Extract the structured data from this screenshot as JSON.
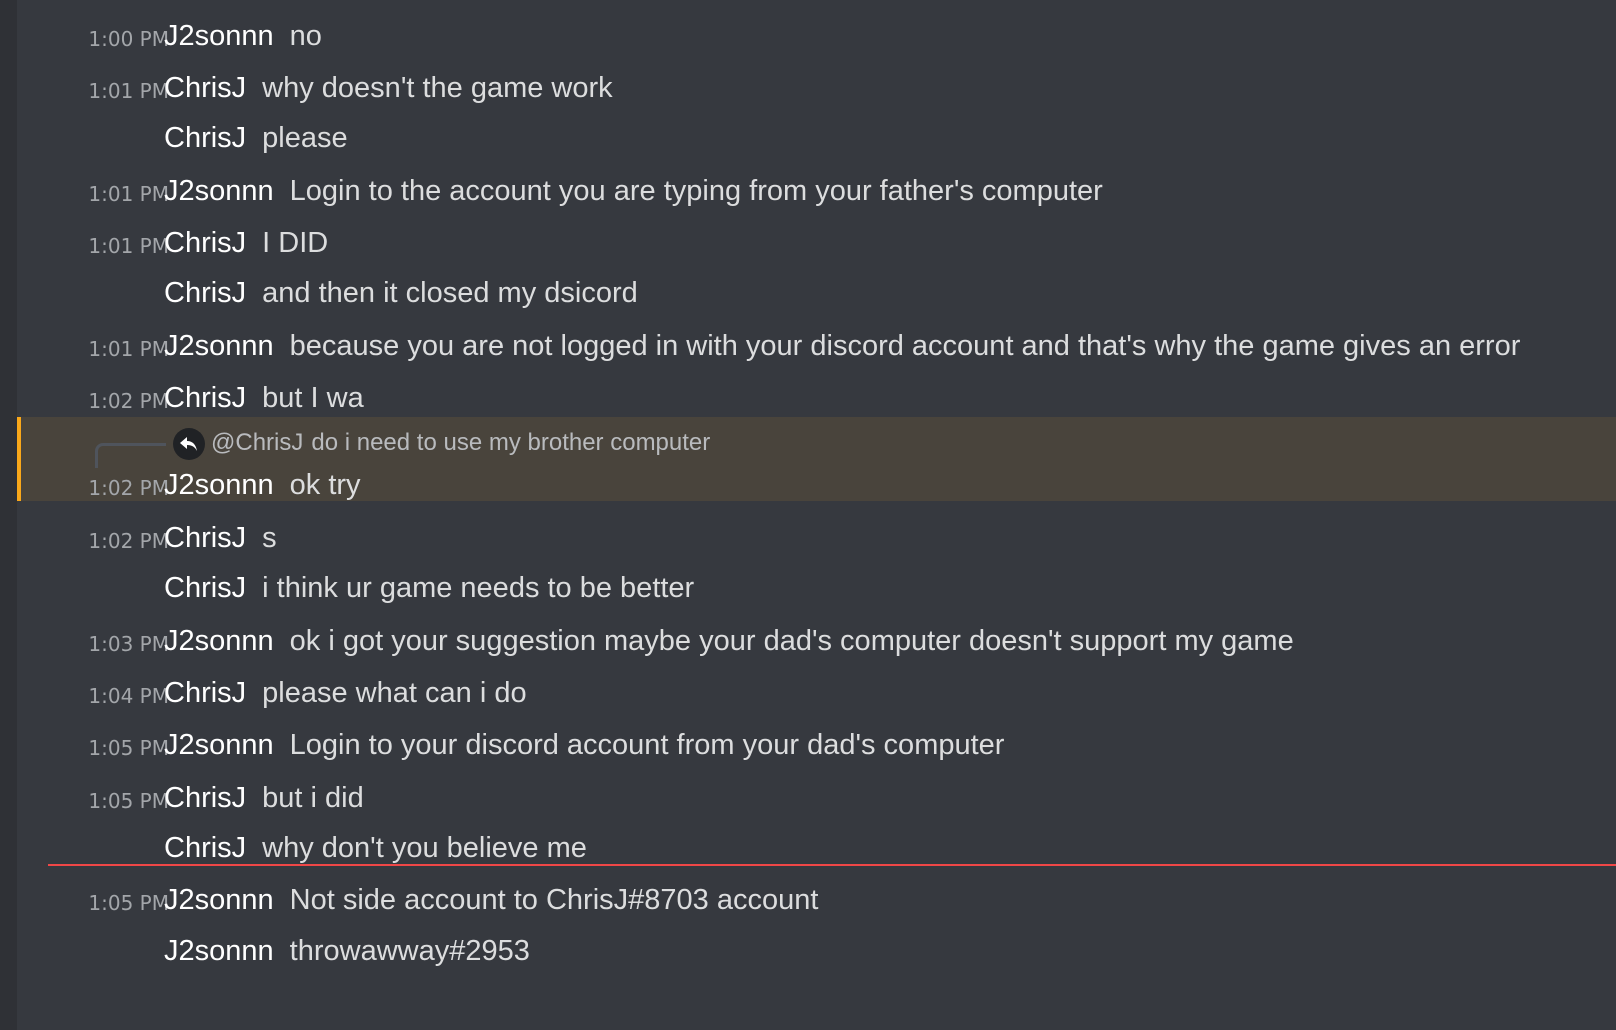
{
  "messages": [
    {
      "time": "1:00 PM",
      "author": "J2sonnn",
      "text": "no"
    },
    {
      "time": "1:01 PM",
      "author": "ChrisJ",
      "text": "why doesn't the game work"
    },
    {
      "time": "",
      "author": "ChrisJ",
      "text": "please"
    },
    {
      "time": "1:01 PM",
      "author": "J2sonnn",
      "text": "Login to the account you are typing from your father's computer"
    },
    {
      "time": "1:01 PM",
      "author": "ChrisJ",
      "text": "I DID"
    },
    {
      "time": "",
      "author": "ChrisJ",
      "text": "and then it closed my dsicord"
    },
    {
      "time": "1:01 PM",
      "author": "J2sonnn",
      "text": "because you are not logged in with your discord account and that's why the game gives an error"
    },
    {
      "time": "1:02 PM",
      "author": "ChrisJ",
      "text": "but I wa"
    },
    {
      "time": "1:02 PM",
      "author": "J2sonnn",
      "text": "ok try"
    },
    {
      "time": "1:02 PM",
      "author": "ChrisJ",
      "text": "s"
    },
    {
      "time": "",
      "author": "ChrisJ",
      "text": "i think ur game needs to be better"
    },
    {
      "time": "1:03 PM",
      "author": "J2sonnn",
      "text": "ok i got your suggestion maybe your dad's computer doesn't support my game"
    },
    {
      "time": "1:04 PM",
      "author": "ChrisJ",
      "text": "please what can i do"
    },
    {
      "time": "1:05 PM",
      "author": "J2sonnn",
      "text": "Login to your discord account from your dad's computer"
    },
    {
      "time": "1:05 PM",
      "author": "ChrisJ",
      "text": "but i did"
    },
    {
      "time": "",
      "author": "ChrisJ",
      "text": "why don't you believe me"
    },
    {
      "time": "1:05 PM",
      "author": "J2sonnn",
      "text": "Not side account to ChrisJ#8703 account"
    },
    {
      "time": "",
      "author": "J2sonnn",
      "text": "throwawway#2953"
    }
  ],
  "reply": {
    "mention": "@ChrisJ",
    "preview": "do i need to use my brother computer",
    "icon": "reply-arrow-icon"
  },
  "colors": {
    "background": "#36393f",
    "highlight": "#49443c",
    "highlight_border": "#faa81a",
    "new_divider": "#f04747"
  }
}
